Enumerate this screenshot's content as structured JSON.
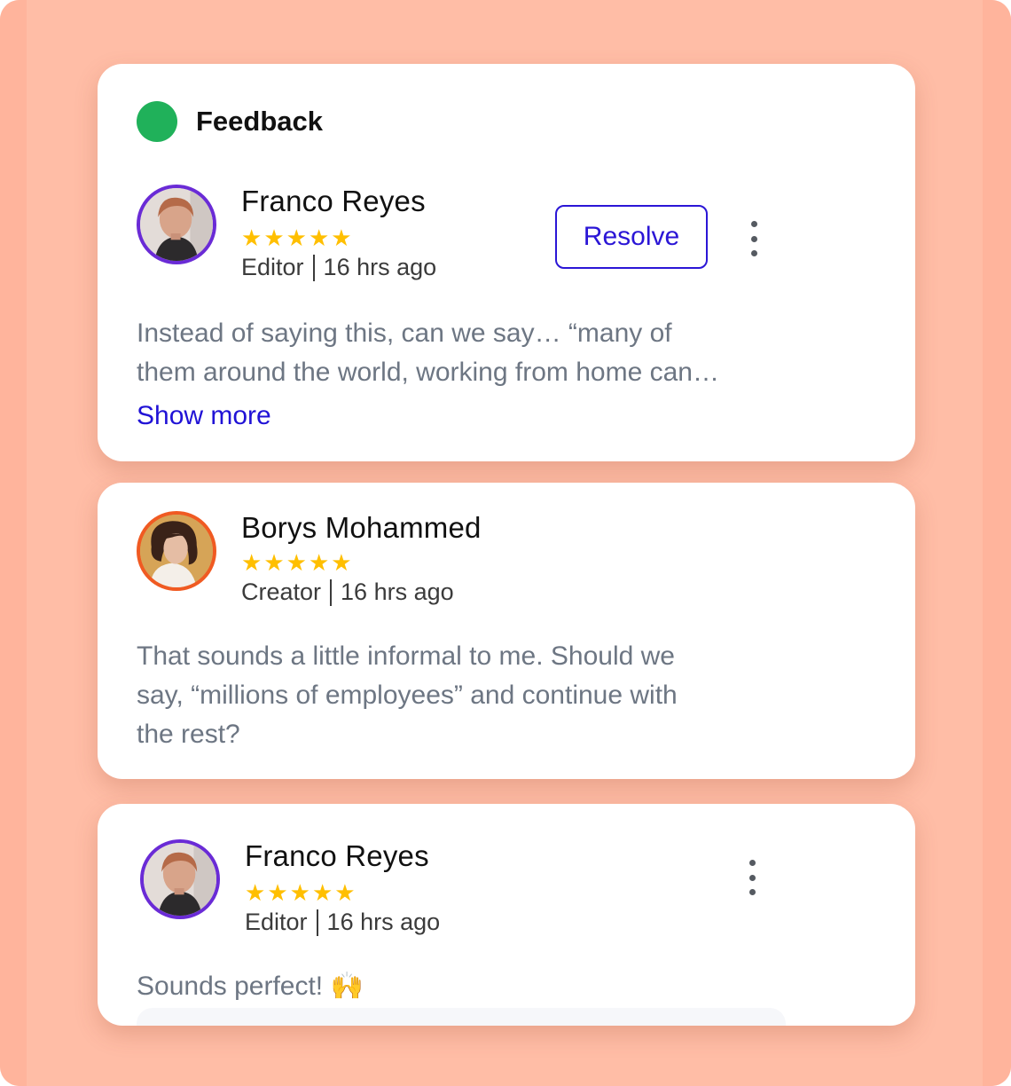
{
  "feedback": {
    "title": "Feedback",
    "status_color": "#20b15a"
  },
  "comments": [
    {
      "author": "Franco Reyes",
      "rating": 5,
      "role": "Editor",
      "time": "16 hrs ago",
      "text_lines": [
        "Instead of saying this, can we say… “many of",
        "them around the world, working from home can…"
      ],
      "show_more_label": "Show more",
      "resolve_label": "Resolve",
      "avatar_ring_color": "#6a2bd6"
    },
    {
      "author": "Borys Mohammed",
      "rating": 5,
      "role": "Creator",
      "time": "16 hrs ago",
      "text_lines": [
        "That sounds a little informal to me. Should we",
        "say, “millions of employees” and continue with",
        "the rest?"
      ],
      "avatar_ring_color": "#f05a22"
    },
    {
      "author": "Franco Reyes",
      "rating": 5,
      "role": "Editor",
      "time": "16 hrs ago",
      "text": "Sounds perfect! 🙌",
      "avatar_ring_color": "#6a2bd6"
    }
  ],
  "icons": {
    "status": "status-dot-icon",
    "more": "more-vertical-icon",
    "star": "star-icon"
  }
}
